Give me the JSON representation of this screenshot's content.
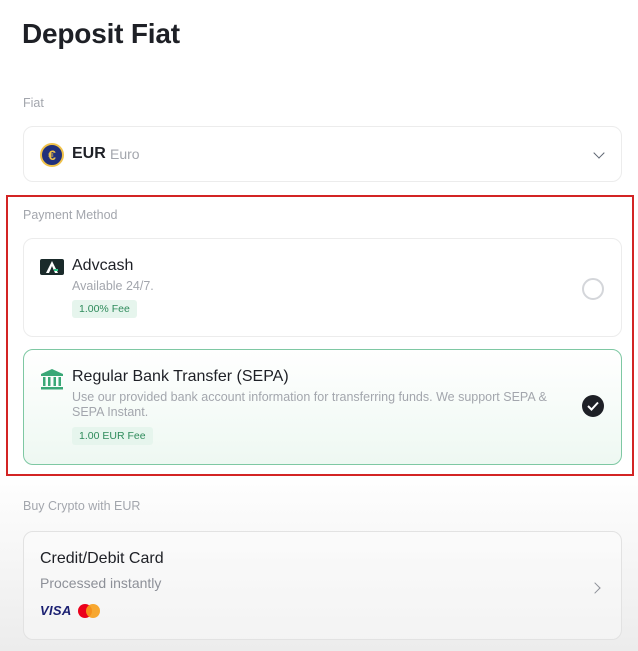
{
  "page": {
    "title": "Deposit Fiat"
  },
  "fiat": {
    "label": "Fiat",
    "selected_code": "EUR",
    "selected_name": "Euro",
    "icon_glyph": "€"
  },
  "payment_method": {
    "label": "Payment Method",
    "options": [
      {
        "name": "Advcash",
        "description": "Available 24/7.",
        "fee": "1.00% Fee",
        "selected": false,
        "icon": "advcash-logo-icon"
      },
      {
        "name": "Regular Bank Transfer (SEPA)",
        "description": "Use our provided bank account information for transferring funds. We support SEPA & SEPA Instant.",
        "fee": "1.00 EUR Fee",
        "selected": true,
        "icon": "bank-icon"
      }
    ]
  },
  "buy_crypto": {
    "label": "Buy Crypto with EUR",
    "card_option": {
      "title": "Credit/Debit Card",
      "subtitle": "Processed instantly",
      "brand_visa": "VISA"
    }
  },
  "colors": {
    "accent_green": "#2e8b5b",
    "highlight_red": "#d32424",
    "text_primary": "#1e2026",
    "text_muted": "#a3a6ad"
  }
}
